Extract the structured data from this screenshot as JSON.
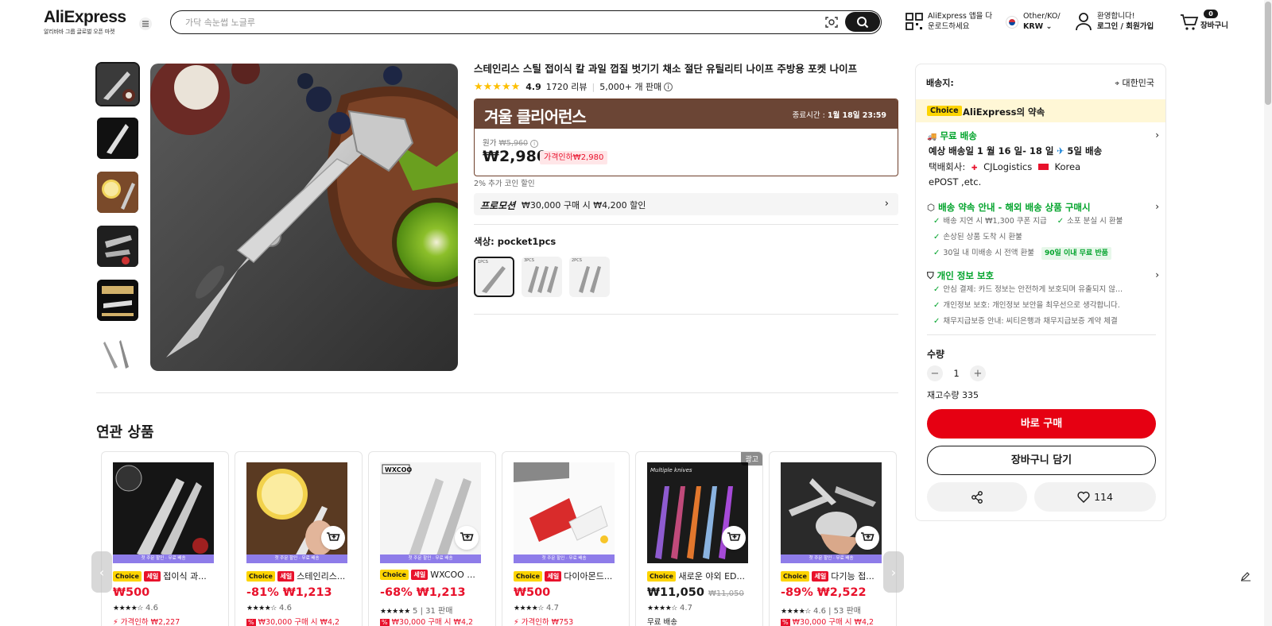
{
  "header": {
    "logo": "AliExpress",
    "logo_sub": "알리바바 그룹 글로벌 오픈 마켓",
    "search_placeholder": "가닥 속눈썹 노글루",
    "app_line1": "AliExpress 앱을 다",
    "app_line2": "운로드하세요",
    "lang_line1": "Other/KO/",
    "lang_line2": "KRW",
    "user_line1": "환영합니다!",
    "user_line2": "로그인 / 회원가입",
    "cart_count": "0",
    "cart_label": "장바구니"
  },
  "product": {
    "title": "스테인리스 스틸 접이식 칼 과일 껍질 벗기기 채소 절단 유틸리티 나이프 주방용 포켓 나이프",
    "stars": "★★★★★",
    "rating": "4.9",
    "reviews": "1720 리뷰",
    "sold": "5,000+ 개 판매",
    "sale_name": "겨울 클리어런스",
    "sale_end_label": "종료시간 :",
    "sale_end": "1월 18일 23:59",
    "orig_label": "원가",
    "orig_price": "₩5,960",
    "price": "₩2,980",
    "discount": "가격인하₩2,980",
    "coin": "2% 추가 코인 할인",
    "promo_label": "프로모션",
    "promo_text": "₩30,000 구매 시 ₩4,200 할인",
    "color_label": "색상: pocket1pcs",
    "swatches": [
      "1PCS",
      "3PCS",
      "2PCS"
    ]
  },
  "panel": {
    "ship_to": "배송지:",
    "ship_dest": "대한민국",
    "choice": "Choice",
    "choice_text": "AliExpress의 약속",
    "free_ship": "무료 배송",
    "eta": "예상 배송일 1 월 16 일- 18 일",
    "eta_fast": "5일 배송",
    "carrier_label": "택배회사:",
    "carrier1": "CJLogistics",
    "carrier2": "Korea",
    "carrier3": "ePOST ,etc.",
    "guarantee_title": "배송 약속 안내 - 해외 배송 상품 구매시",
    "g1": "배송 지연 시 ₩1,300 쿠폰 지급",
    "g2": "소포 분실 시 환불",
    "g3": "손상된 상품 도착 시 환불",
    "g4": "30일 내 미배송 시 전액 환불",
    "g4_tag": "90일 이내 무료 반품",
    "privacy_title": "개인 정보 보호",
    "p1": "안심 결제: 카드 정보는 안전하게 보호되며 유출되지 않...",
    "p2": "개인정보 보호: 개인정보 보안을 최우선으로 생각합니다.",
    "p3": "채무지급보증 안내: 씨티은행과 채무지급보증 계약 체결",
    "qty_label": "수량",
    "qty": "1",
    "stock": "재고수량 335",
    "buy": "바로 구매",
    "add_cart": "장바구니 담기",
    "wish_count": "114"
  },
  "related": {
    "title": "연관 상품",
    "banner": "첫 주문 할인 · 무료 배송",
    "ad": "광고",
    "cards": [
      {
        "name": "접이식 과...",
        "price": "₩500",
        "stars": "★★★★☆",
        "rating": "4.6",
        "sold": "",
        "extra": "가격인하 ₩2,227",
        "sale": true
      },
      {
        "name": "스테인리스...",
        "price": "-81% ₩1,213",
        "stars": "★★★★☆",
        "rating": "4.6",
        "sold": "",
        "extra": "₩30,000 구매 시 ₩4,2",
        "sale": true
      },
      {
        "name": "WXCOO ...",
        "price": "-68% ₩1,213",
        "stars": "★★★★★",
        "rating": "5",
        "sold": "31 판매",
        "extra": "₩30,000 구매 시 ₩4,2",
        "sale": true
      },
      {
        "name": "다이아몬드...",
        "price": "₩500",
        "stars": "★★★★☆",
        "rating": "4.7",
        "sold": "",
        "extra": "가격인하 ₩753",
        "sale": true
      },
      {
        "name": "새로운 야외 ED...",
        "price": "₩11,050",
        "orig": "₩11,050",
        "stars": "★★★★☆",
        "rating": "4.7",
        "sold": "",
        "extra": "무료 배송",
        "sale": false
      },
      {
        "name": "다기능 접...",
        "price": "-89% ₩2,522",
        "stars": "★★★★☆",
        "rating": "4.6",
        "sold": "53 판매",
        "extra": "₩30,000 구매 시 ₩4,2",
        "sale": true
      }
    ],
    "badge_choice": "Choice",
    "badge_sale": "세일"
  }
}
